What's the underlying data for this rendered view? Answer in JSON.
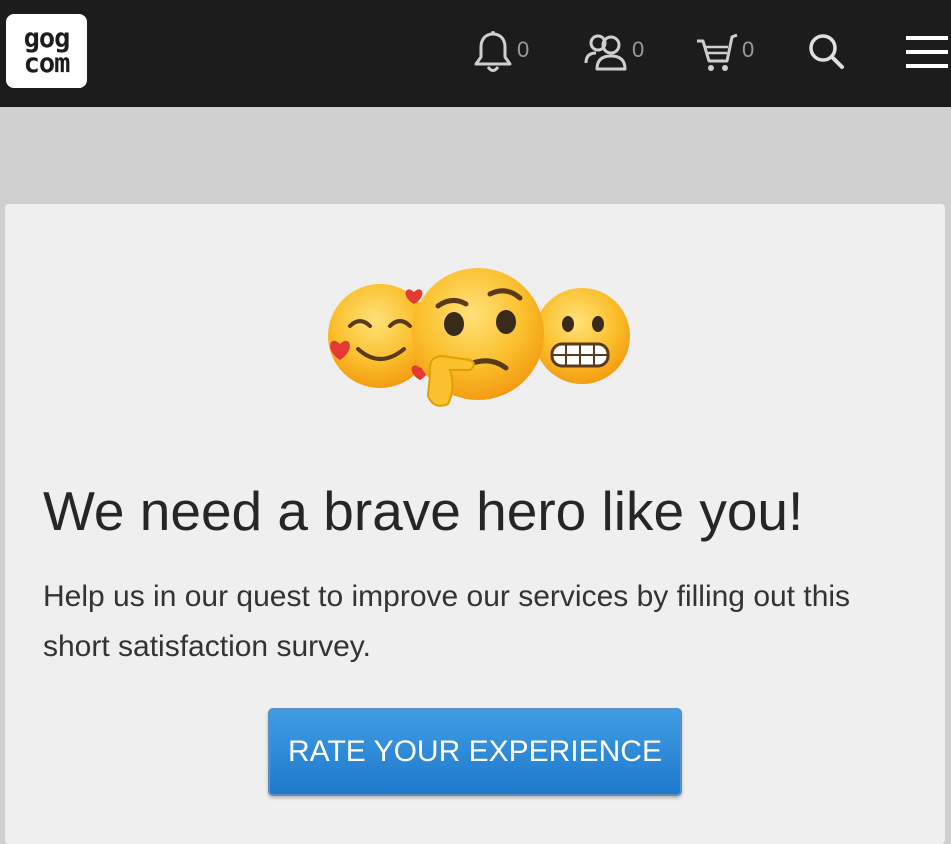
{
  "header": {
    "logo": {
      "line1": "gog",
      "line2": "com"
    },
    "notifications": {
      "icon": "bell-icon",
      "count": "0"
    },
    "friends": {
      "icon": "friends-icon",
      "count": "0"
    },
    "cart": {
      "icon": "cart-icon",
      "count": "0"
    },
    "search": {
      "icon": "search-icon"
    },
    "menu": {
      "icon": "hamburger-menu-icon"
    }
  },
  "survey": {
    "emojis": [
      "smiling-face-with-hearts",
      "thinking-face",
      "grimacing-face"
    ],
    "headline": "We need a brave hero like you!",
    "body": "Help us in our quest to improve our services by filling out this short satisfaction survey.",
    "button_label": "RATE YOUR EXPERIENCE"
  },
  "colors": {
    "header_bg": "#1c1c1c",
    "page_bg": "#cfcfcf",
    "card_bg": "#efefef",
    "button_blue": "#2a88d6"
  }
}
